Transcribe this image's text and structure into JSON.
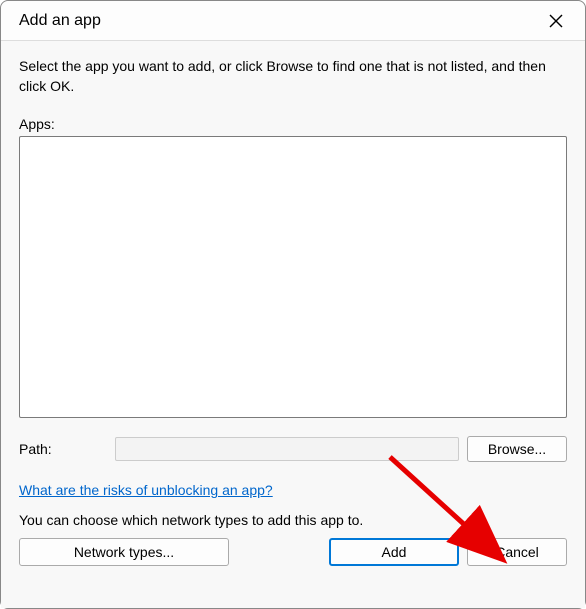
{
  "titlebar": {
    "title": "Add an app"
  },
  "instruction": "Select the app you want to add, or click Browse to find one that is not listed, and then click OK.",
  "apps_label": "Apps:",
  "path": {
    "label": "Path:",
    "value": "",
    "browse_label": "Browse..."
  },
  "risk_link": "What are the risks of unblocking an app?",
  "network_text": "You can choose which network types to add this app to.",
  "buttons": {
    "network_types": "Network types...",
    "add": "Add",
    "cancel": "Cancel"
  },
  "annotation": {
    "arrow_color": "#e60000"
  }
}
